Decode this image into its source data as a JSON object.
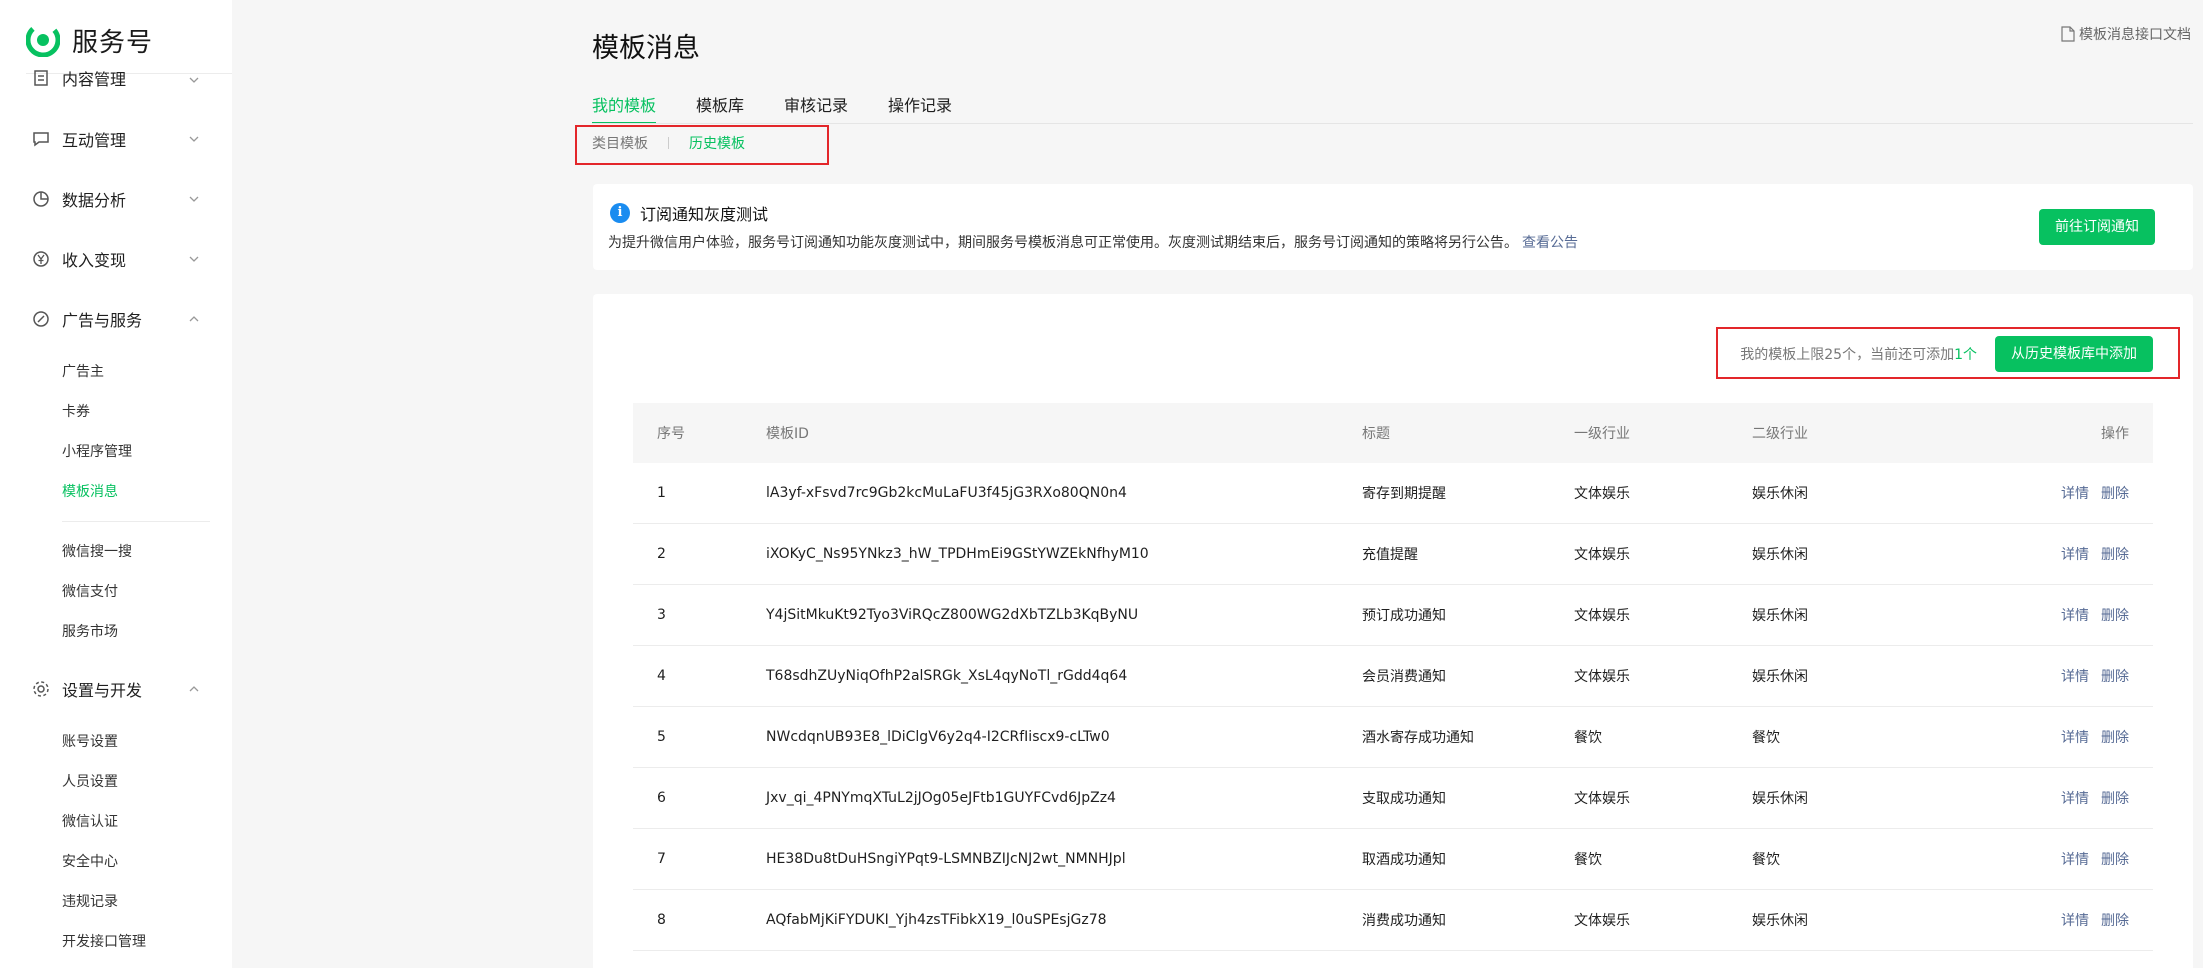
{
  "sidebar": {
    "brand": "服务号",
    "groups": [
      {
        "label": "内容管理",
        "icon": "content-doc-icon"
      },
      {
        "label": "互动管理",
        "icon": "chat-bubble-icon"
      },
      {
        "label": "数据分析",
        "icon": "pie-chart-icon"
      },
      {
        "label": "收入变现",
        "icon": "yen-circle-icon"
      },
      {
        "label": "广告与服务",
        "icon": "compass-icon"
      },
      {
        "label": "设置与开发",
        "icon": "gear-icon"
      }
    ],
    "ads_items": [
      "广告主",
      "卡券",
      "小程序管理",
      "模板消息"
    ],
    "ads_items2": [
      "微信搜一搜",
      "微信支付",
      "服务市场"
    ],
    "settings_items": [
      "账号设置",
      "人员设置",
      "微信认证",
      "安全中心",
      "违规记录",
      "开发接口管理"
    ]
  },
  "header": {
    "title": "模板消息",
    "doc_link": "模板消息接口文档"
  },
  "tabs": [
    "我的模板",
    "模板库",
    "审核记录",
    "操作记录"
  ],
  "subtabs": [
    "类目模板",
    "历史模板"
  ],
  "notice": {
    "title": "订阅通知灰度测试",
    "body": "为提升微信用户体验，服务号订阅通知功能灰度测试中，期间服务号模板消息可正常使用。灰度测试期结束后，服务号订阅通知的策略将另行公告。",
    "link": "查看公告",
    "button": "前往订阅通知"
  },
  "quota": {
    "prefix": "我的模板上限25个，当前还可添加",
    "count": "1个",
    "button": "从历史模板库中添加"
  },
  "table": {
    "headers": [
      "序号",
      "模板ID",
      "标题",
      "一级行业",
      "二级行业",
      "操作"
    ],
    "detail_label": "详情",
    "delete_label": "删除",
    "rows": [
      {
        "no": "1",
        "id": "lA3yf-xFsvd7rc9Gb2kcMuLaFU3f45jG3RXo80QN0n4",
        "title": "寄存到期提醒",
        "ind1": "文体娱乐",
        "ind2": "娱乐休闲"
      },
      {
        "no": "2",
        "id": "iXOKyC_Ns95YNkz3_hW_TPDHmEi9GStYWZEkNfhyM10",
        "title": "充值提醒",
        "ind1": "文体娱乐",
        "ind2": "娱乐休闲"
      },
      {
        "no": "3",
        "id": "Y4jSitMkuKt92Tyo3ViRQcZ800WG2dXbTZLb3KqByNU",
        "title": "预订成功通知",
        "ind1": "文体娱乐",
        "ind2": "娱乐休闲"
      },
      {
        "no": "4",
        "id": "T68sdhZUyNiqOfhP2alSRGk_XsL4qyNoTl_rGdd4q64",
        "title": "会员消费通知",
        "ind1": "文体娱乐",
        "ind2": "娱乐休闲"
      },
      {
        "no": "5",
        "id": "NWcdqnUB93E8_lDiClgV6y2q4-I2CRfIiscx9-cLTw0",
        "title": "酒水寄存成功通知",
        "ind1": "餐饮",
        "ind2": "餐饮"
      },
      {
        "no": "6",
        "id": "Jxv_qi_4PNYmqXTuL2jJOg05eJFtb1GUYFCvd6JpZz4",
        "title": "支取成功通知",
        "ind1": "文体娱乐",
        "ind2": "娱乐休闲"
      },
      {
        "no": "7",
        "id": "HE38Du8tDuHSngiYPqt9-LSMNBZIJcNJ2wt_NMNHJpl",
        "title": "取酒成功通知",
        "ind1": "餐饮",
        "ind2": "餐饮"
      },
      {
        "no": "8",
        "id": "AQfabMjKiFYDUKI_Yjh4zsTFibkX19_l0uSPEsjGz78",
        "title": "消费成功通知",
        "ind1": "文体娱乐",
        "ind2": "娱乐休闲"
      }
    ]
  },
  "colors": {
    "accent": "#07c160",
    "link": "#576b95",
    "highlight_box": "#e3262a",
    "info": "#1a8cf0"
  }
}
